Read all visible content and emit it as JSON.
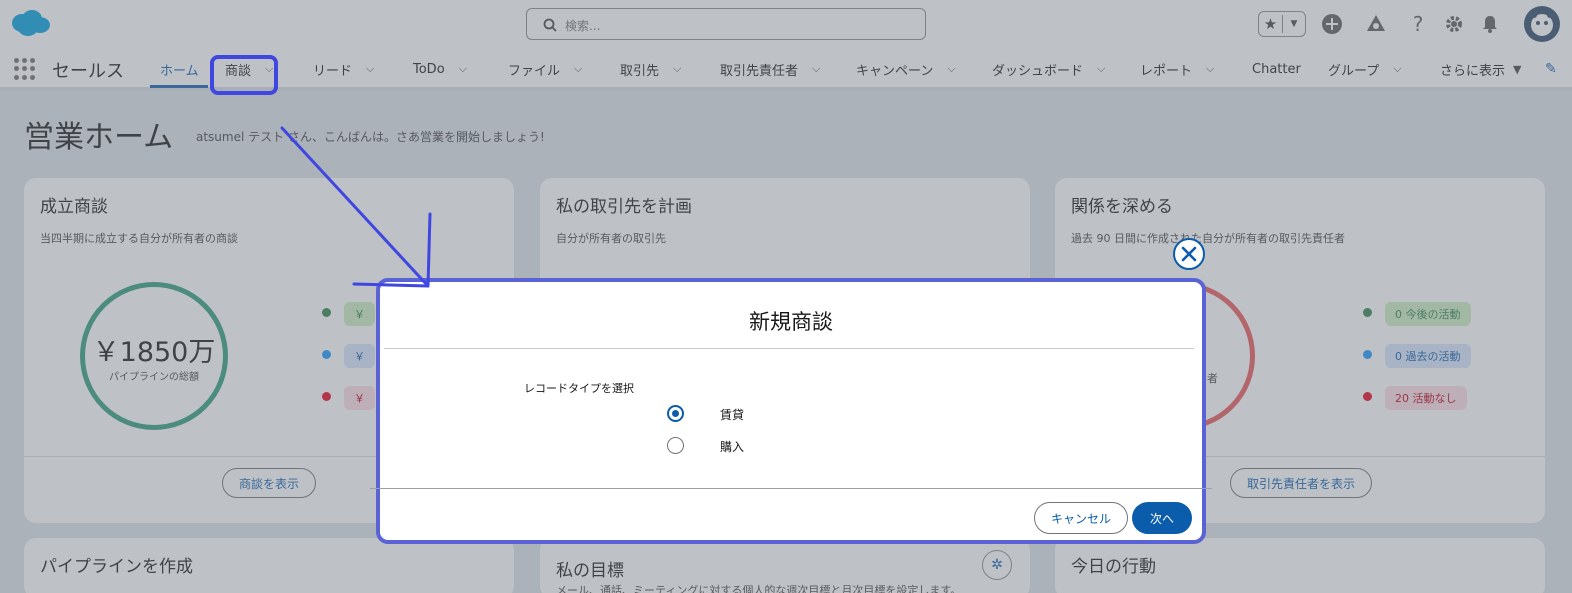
{
  "header": {
    "search_placeholder": "検索..."
  },
  "nav": {
    "app_name": "セールス",
    "items": [
      {
        "label": "ホーム",
        "has_menu": false
      },
      {
        "label": "商談",
        "has_menu": true
      },
      {
        "label": "リード",
        "has_menu": true
      },
      {
        "label": "ToDo",
        "has_menu": true
      },
      {
        "label": "ファイル",
        "has_menu": true
      },
      {
        "label": "取引先",
        "has_menu": true
      },
      {
        "label": "取引先責任者",
        "has_menu": true
      },
      {
        "label": "キャンペーン",
        "has_menu": true
      },
      {
        "label": "ダッシュボード",
        "has_menu": true
      },
      {
        "label": "レポート",
        "has_menu": true
      },
      {
        "label": "Chatter",
        "has_menu": false
      },
      {
        "label": "グループ",
        "has_menu": true
      },
      {
        "label": "さらに表示",
        "has_menu": true
      }
    ]
  },
  "page": {
    "title": "営業ホーム",
    "greeting": "atsumel テスト さん、こんばんは。さあ営業を開始しましょう!"
  },
  "cards": {
    "closed": {
      "title": "成立商談",
      "subtitle": "当四半期に成立する自分が所有者の商談",
      "amount": "￥1850万",
      "amount_label": "パイプラインの総額",
      "pills": [
        "￥",
        "￥",
        "￥"
      ],
      "button": "商談を表示"
    },
    "plan": {
      "title": "私の取引先を計画",
      "subtitle": "自分が所有者の取引先"
    },
    "relations": {
      "title": "関係を深める",
      "subtitle": "過去 90 日間に作成された自分が所有者の取引先責任者",
      "ring_text": "者",
      "pills": [
        "0 今後の活動",
        "0 過去の活動",
        "20 活動なし"
      ],
      "button": "取引先責任者を表示"
    },
    "pipeline": {
      "title": "パイプラインを作成"
    },
    "goals": {
      "title": "私の目標",
      "subtitle": "メール、通話、ミーティングに対する個人的な週次目標と月次目標を設定します。"
    },
    "today": {
      "title": "今日の行動"
    }
  },
  "modal": {
    "title": "新規商談",
    "record_type_label": "レコードタイプを選択",
    "options": [
      {
        "label": "賃貸",
        "selected": true
      },
      {
        "label": "購入",
        "selected": false
      }
    ],
    "cancel": "キャンセル",
    "next": "次へ"
  },
  "colors": {
    "accent": "#0b5cab",
    "annotation": "#3f47e0",
    "green": "#2e844a",
    "blue": "#1b96ff",
    "red": "#ea001e"
  }
}
